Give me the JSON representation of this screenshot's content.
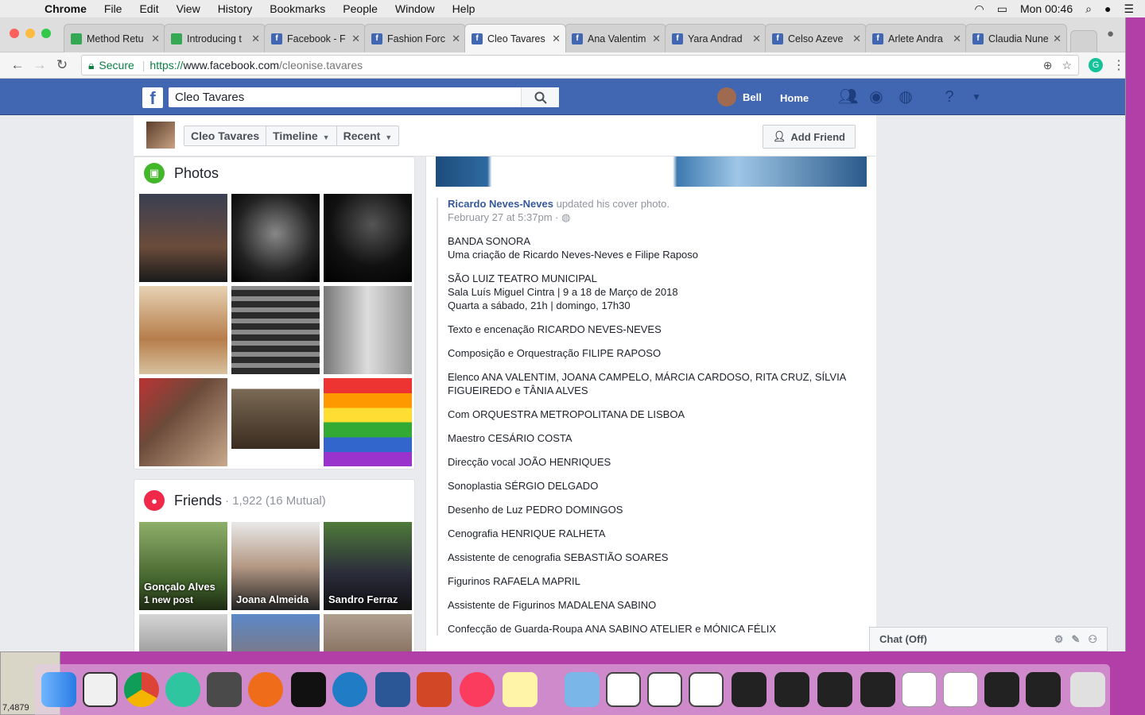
{
  "menubar": {
    "app": "Chrome",
    "items": [
      "File",
      "Edit",
      "View",
      "History",
      "Bookmarks",
      "People",
      "Window",
      "Help"
    ],
    "clock": "Mon 00:46"
  },
  "tabs": [
    {
      "title": "Method Retu",
      "color": "#35a853"
    },
    {
      "title": "Introducing t",
      "color": "#35a853"
    },
    {
      "title": "Facebook - F",
      "color": "#4267b2"
    },
    {
      "title": "Fashion Forc",
      "color": "#4267b2"
    },
    {
      "title": "Cleo Tavares",
      "color": "#4267b2",
      "active": true
    },
    {
      "title": "Ana Valentim",
      "color": "#4267b2"
    },
    {
      "title": "Yara Andrad",
      "color": "#4267b2"
    },
    {
      "title": "Celso Azeve",
      "color": "#4267b2"
    },
    {
      "title": "Arlete Andra",
      "color": "#4267b2"
    },
    {
      "title": "Claudia Nune",
      "color": "#4267b2"
    }
  ],
  "address": {
    "secure": "Secure",
    "scheme": "https://",
    "host": "www.facebook.com",
    "path": "/cleonise.tavares"
  },
  "fb": {
    "logo": "f",
    "search_value": "Cleo Tavares",
    "user": "Bell",
    "home": "Home"
  },
  "profile": {
    "crumbs": [
      "Cleo Tavares",
      "Timeline",
      "Recent"
    ],
    "add_friend": "Add Friend"
  },
  "photos": {
    "title": "Photos"
  },
  "friends": {
    "title": "Friends",
    "count": "· 1,922 (16 Mutual)",
    "items": [
      {
        "name": "Gonçalo Alves",
        "note": "1 new post"
      },
      {
        "name": "Joana Almeida"
      },
      {
        "name": "Sandro Ferraz"
      }
    ]
  },
  "post": {
    "author": "Ricardo Neves-Neves",
    "action": "updated his cover photo.",
    "time": "February 27 at 5:37pm ·",
    "lines": [
      "BANDA SONORA\nUma criação de Ricardo Neves-Neves e Filipe Raposo",
      "SÃO LUIZ TEATRO MUNICIPAL\nSala Luís Miguel Cintra | 9 a 18 de Março de 2018\nQuarta a sábado, 21h | domingo, 17h30",
      "Texto e encenação RICARDO NEVES-NEVES",
      "Composição e Orquestração FILIPE RAPOSO",
      "Elenco ANA VALENTIM, JOANA CAMPELO, MÁRCIA CARDOSO, RITA CRUZ, SÍLVIA FIGUEIREDO e TÂNIA ALVES",
      "Com ORQUESTRA METROPOLITANA DE LISBOA",
      "Maestro CESÁRIO COSTA",
      "Direcção vocal JOÃO HENRIQUES",
      "Sonoplastia SÉRGIO DELGADO",
      "Desenho de Luz PEDRO DOMINGOS",
      "Cenografia HENRIQUE RALHETA",
      "Assistente de cenografia SEBASTIÃO SOARES",
      "Figurinos RAFAELA MAPRIL",
      "Assistente de Figurinos MADALENA SABINO",
      "Confecção de Guarda-Roupa ANA SABINO ATELIER e MÓNICA FÉLIX"
    ]
  },
  "chat": {
    "label": "Chat (Off)"
  },
  "desktop_thumb": "7,4879"
}
